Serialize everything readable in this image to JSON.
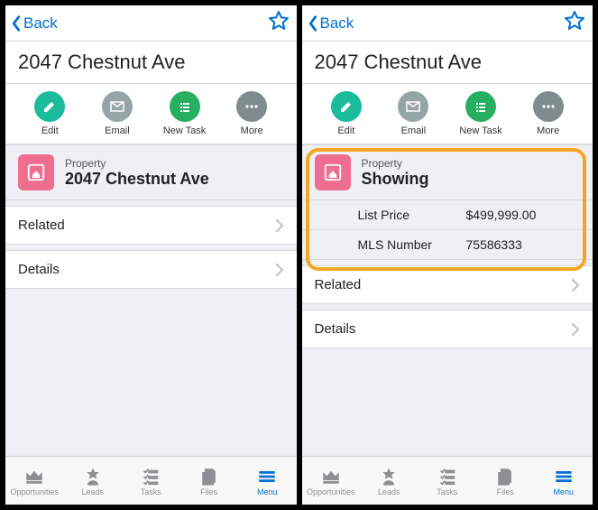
{
  "nav": {
    "back": "Back"
  },
  "page": {
    "title": "2047 Chestnut Ave"
  },
  "actions": {
    "edit": "Edit",
    "email": "Email",
    "newtask": "New Task",
    "more": "More"
  },
  "record": {
    "eyebrow": "Property",
    "nameA": "2047 Chestnut Ave",
    "nameB": "Showing",
    "fields": {
      "listPrice": {
        "label": "List Price",
        "value": "$499,999.00"
      },
      "mls": {
        "label": "MLS Number",
        "value": "75586333"
      }
    }
  },
  "rows": {
    "related": "Related",
    "details": "Details"
  },
  "tabs": {
    "opportunities": "Opportunities",
    "leads": "Leads",
    "tasks": "Tasks",
    "files": "Files",
    "menu": "Menu"
  }
}
